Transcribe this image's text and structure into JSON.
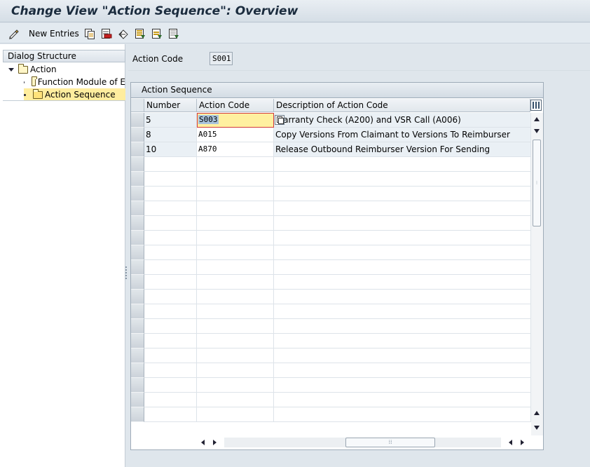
{
  "window": {
    "title": "Change View \"Action Sequence\": Overview"
  },
  "toolbar": {
    "items": [
      {
        "icon": "change-display-icon"
      },
      {
        "icon": "new-entries-icon",
        "label": "New Entries"
      },
      {
        "icon": "copy-as-icon"
      },
      {
        "icon": "delete-icon"
      },
      {
        "icon": "undo-change-icon"
      },
      {
        "icon": "select-all-icon"
      },
      {
        "icon": "select-block-icon"
      },
      {
        "icon": "deselect-all-icon"
      }
    ]
  },
  "dialog_structure": {
    "header": "Dialog Structure",
    "items": [
      {
        "label": "Action",
        "level": 0,
        "expanded": true,
        "selected": false
      },
      {
        "label": "Function Module of E",
        "level": 1,
        "selected": false
      },
      {
        "label": "Action Sequence",
        "level": 1,
        "selected": true
      }
    ]
  },
  "header_field": {
    "label": "Action Code",
    "value": "S001"
  },
  "table": {
    "caption": "Action Sequence",
    "columns": [
      "Number",
      "Action Code",
      "Description of Action Code"
    ],
    "rows": [
      {
        "number": "5",
        "action_code": "S003",
        "description": "Warranty Check (A200) and VSR Call (A006)"
      },
      {
        "number": "8",
        "action_code": "A015",
        "description": "Copy Versions From Claimant to Versions To Reimburser"
      },
      {
        "number": "10",
        "action_code": "A870",
        "description": "Release Outbound Reimburser Version For Sending"
      }
    ],
    "empty_rows": 18
  },
  "colors": {
    "focus_cell": "#fff0a0",
    "selected_tree": "#ffed9e",
    "readonly_cell": "#eaf0f5"
  }
}
